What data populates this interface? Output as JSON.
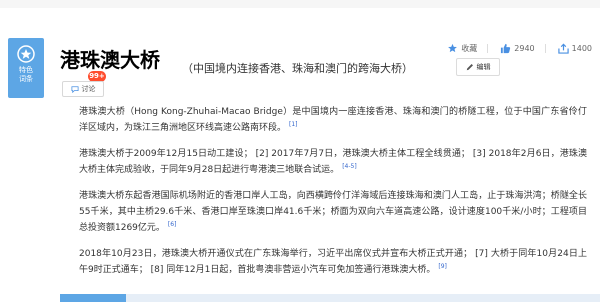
{
  "badge": {
    "line1": "特色",
    "line2": "词条"
  },
  "topbar": {
    "collect_label": "收藏",
    "like_count": "2940",
    "share_count": "1400"
  },
  "header": {
    "title": "港珠澳大桥",
    "subtitle": "（中国境内连接香港、珠海和澳门的跨海大桥）",
    "edit_label": "编辑",
    "count_badge": "99+",
    "discuss_label": "讨论"
  },
  "paragraphs": [
    {
      "text": "港珠澳大桥（Hong Kong-Zhuhai-Macao Bridge）是中国境内一座连接香港、珠海和澳门的桥隧工程，位于中国广东省伶仃洋区域内，为珠江三角洲地区环线高速公路南环段。",
      "ref": "[1]"
    },
    {
      "text": "港珠澳大桥于2009年12月15日动工建设； [2]  2017年7月7日，港珠澳大桥主体工程全线贯通； [3]  2018年2月6日，港珠澳大桥主体完成验收，于同年9月28日起进行粤港澳三地联合试运。",
      "ref": "[4-5]"
    },
    {
      "text": "港珠澳大桥东起香港国际机场附近的香港口岸人工岛，向西横跨伶仃洋海域后连接珠海和澳门人工岛，止于珠海洪湾；桥隧全长55千米，其中主桥29.6千米、香港口岸至珠澳口岸41.6千米；桥面为双向六车道高速公路，设计速度100千米/小时；工程项目总投资额1269亿元。",
      "ref": "[6]"
    },
    {
      "text": "2018年10月23日，港珠澳大桥开通仪式在广东珠海举行，习近平出席仪式并宣布大桥正式开通； [7]  大桥于同年10月24日上午9时正式通车； [8]  同年12月1日起，首批粤澳非营运小汽车可免加签通行港珠澳大桥。",
      "ref": "[9]"
    }
  ],
  "colors": {
    "accent": "#5da6e5",
    "badge_red": "#ff4d2e",
    "link": "#3366cc"
  },
  "icons": {
    "badge": "star-badge-icon",
    "collect": "star-icon",
    "like": "thumbs-up-icon",
    "share": "share-icon",
    "edit": "pencil-icon",
    "discuss": "chat-icon"
  }
}
